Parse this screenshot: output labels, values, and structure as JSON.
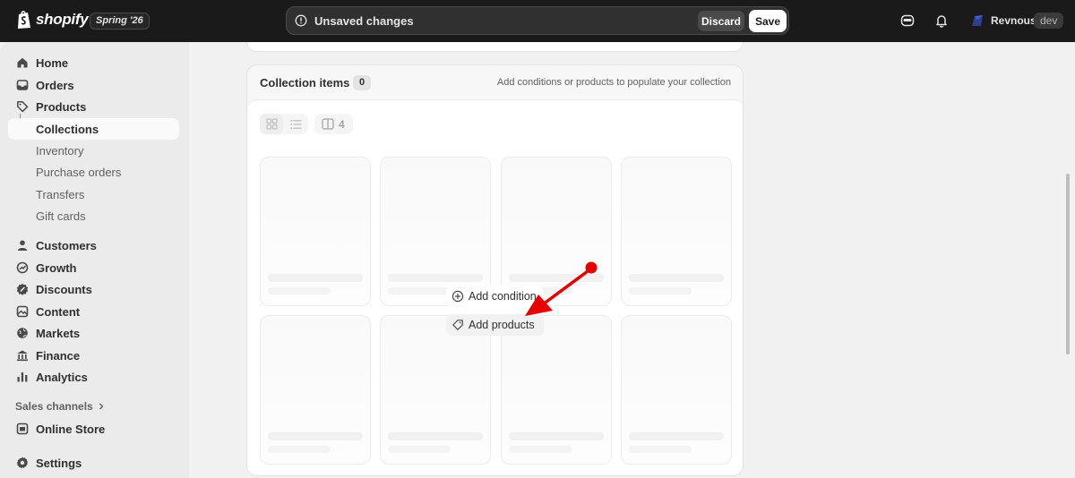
{
  "topbar": {
    "logo_text": "shopify",
    "edition_badge": "Spring '26",
    "unsaved_text": "Unsaved changes",
    "discard_label": "Discard",
    "save_label": "Save",
    "user_name": "Revnous",
    "store_badge": "dev"
  },
  "sidebar": {
    "items": [
      {
        "label": "Home",
        "icon": "home-icon"
      },
      {
        "label": "Orders",
        "icon": "inbox-icon"
      },
      {
        "label": "Products",
        "icon": "tag-icon"
      }
    ],
    "active_sub": "Collections",
    "sub_items": [
      "Inventory",
      "Purchase orders",
      "Transfers",
      "Gift cards"
    ],
    "items2": [
      {
        "label": "Customers",
        "icon": "person-icon"
      },
      {
        "label": "Growth",
        "icon": "growth-icon"
      },
      {
        "label": "Discounts",
        "icon": "discount-icon"
      },
      {
        "label": "Content",
        "icon": "content-icon"
      },
      {
        "label": "Markets",
        "icon": "globe-icon"
      },
      {
        "label": "Finance",
        "icon": "bank-icon"
      },
      {
        "label": "Analytics",
        "icon": "chart-icon"
      }
    ],
    "sales_channels_label": "Sales channels",
    "online_store_label": "Online Store",
    "settings_label": "Settings"
  },
  "collection_items": {
    "title": "Collection items",
    "count": "0",
    "hint": "Add conditions or products to populate your collection",
    "columns_count": "4",
    "add_condition_label": "Add condition",
    "add_products_label": "Add products"
  },
  "colors": {
    "topbar_bg": "#1a1a1a",
    "annotation_arrow": "#e60000"
  }
}
